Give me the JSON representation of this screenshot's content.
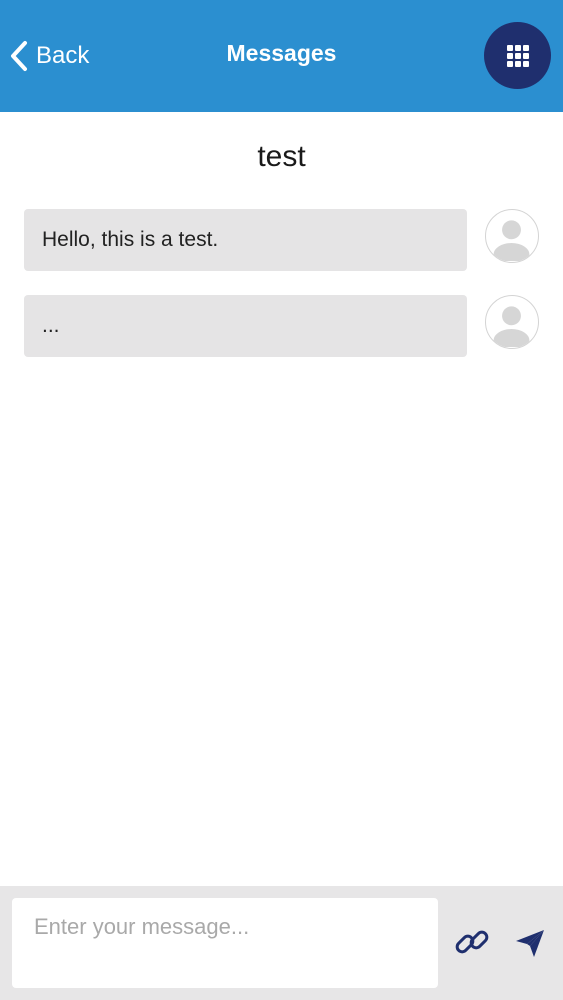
{
  "header": {
    "back_label": "Back",
    "title": "Messages",
    "background_color": "#2b8fd0",
    "apps_button_color": "#1f2f6e",
    "icons": {
      "back": "chevron-left-icon",
      "apps": "grid-icon"
    }
  },
  "conversation": {
    "title": "test",
    "messages": [
      {
        "text": "Hello, this is a test.",
        "avatar": "user-avatar-icon"
      },
      {
        "text": "...",
        "avatar": "user-avatar-icon"
      }
    ]
  },
  "composer": {
    "placeholder": "Enter your message...",
    "icons": {
      "attach": "link-icon",
      "send": "send-icon"
    },
    "icon_color": "#1f2f6e",
    "background_color": "#e7e6e7"
  }
}
